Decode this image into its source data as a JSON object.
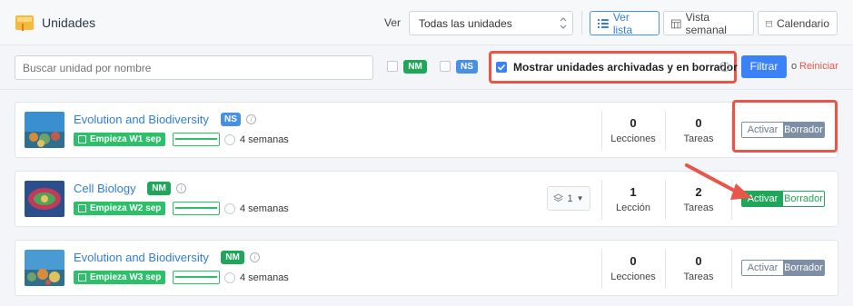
{
  "header": {
    "title": "Unidades",
    "view_label": "Ver",
    "view_select_value": "Todas las unidades",
    "view_buttons": [
      {
        "label": "Ver lista",
        "active": true
      },
      {
        "label": "Vista semanal",
        "active": false
      },
      {
        "label": "Calendario",
        "active": false
      }
    ]
  },
  "filters": {
    "search_placeholder": "Buscar unidad por nombre",
    "nm_badge": "NM",
    "ns_badge": "NS",
    "archived_label": "Mostrar unidades archivadas y en borrador",
    "archived_checked": true,
    "filter_button": "Filtrar",
    "or_text": "o",
    "reset_link": "Reiniciar"
  },
  "units": [
    {
      "title": "Evolution and Biodiversity",
      "level": "NS",
      "start": "Empieza W1 sep",
      "duration": "4 semanas",
      "lessons_count": "0",
      "lessons_label": "Lecciones",
      "tasks_count": "0",
      "tasks_label": "Tareas",
      "toggle_left": "Activar",
      "toggle_right": "Borrador",
      "state": "draft"
    },
    {
      "title": "Cell Biology",
      "level": "NM",
      "start": "Empieza W2 sep",
      "duration": "4 semanas",
      "layers_count": "1",
      "lessons_count": "1",
      "lessons_label": "Lección",
      "tasks_count": "2",
      "tasks_label": "Tareas",
      "toggle_left": "Activar",
      "toggle_right": "Borrador",
      "state": "active"
    },
    {
      "title": "Evolution and Biodiversity",
      "level": "NM",
      "start": "Empieza W3 sep",
      "duration": "4 semanas",
      "lessons_count": "0",
      "lessons_label": "Lecciones",
      "tasks_count": "0",
      "tasks_label": "Tareas",
      "toggle_left": "Activar",
      "toggle_right": "Borrador",
      "state": "draft"
    }
  ],
  "colors": {
    "accent": "#3b82f6",
    "nm": "#20a65a",
    "ns": "#4a90e2",
    "highlight": "#e8564a"
  }
}
